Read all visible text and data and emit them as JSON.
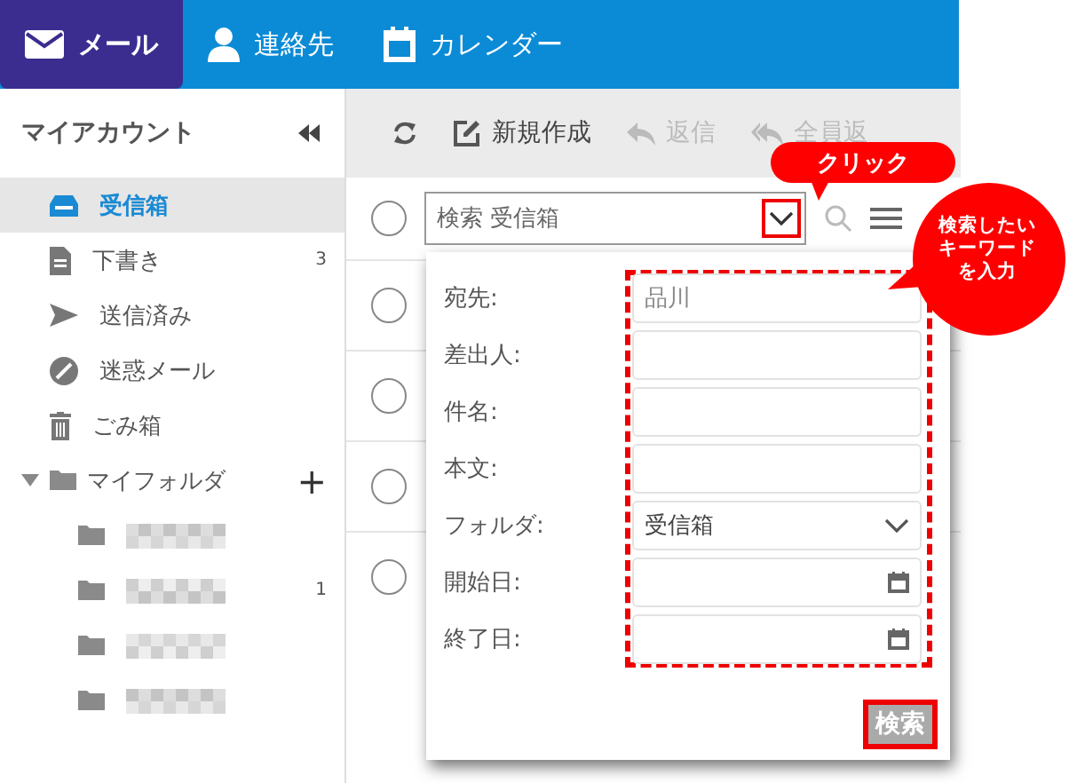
{
  "nav_tabs": [
    {
      "label": "メール",
      "selected": true
    },
    {
      "label": "連絡先",
      "selected": false
    },
    {
      "label": "カレンダー",
      "selected": false
    }
  ],
  "sidebar": {
    "title": "マイアカウント",
    "items": [
      {
        "label": "受信箱",
        "selected": true
      },
      {
        "label": "下書き",
        "count": "3",
        "selected": false
      },
      {
        "label": "送信済み",
        "selected": false
      },
      {
        "label": "迷惑メール",
        "selected": false
      },
      {
        "label": "ごみ箱",
        "selected": false
      }
    ],
    "my_folders": {
      "label": "マイフォルダ",
      "expanded": true,
      "add": "+",
      "children": [
        {
          "kind": "pixelated"
        },
        {
          "kind": "pixelated",
          "count": "1"
        },
        {
          "kind": "pixelated"
        },
        {
          "kind": "pixelated"
        }
      ]
    }
  },
  "toolbar": [
    {
      "disabled": false
    },
    {
      "label": "新規作成",
      "disabled": false
    },
    {
      "label": "返信",
      "disabled": true
    },
    {
      "label": "全員返",
      "disabled": true
    }
  ],
  "select_all": {
    "checked": false
  },
  "search": {
    "placeholder": "検索 受信箱"
  },
  "message_rows": [
    {
      "checked": false
    },
    {
      "checked": false
    },
    {
      "checked": false
    },
    {
      "checked": false
    }
  ],
  "search_form": {
    "fields": [
      {
        "label": "宛先:",
        "kind": "text",
        "placeholder": "品川"
      },
      {
        "label": "差出人:",
        "kind": "text"
      },
      {
        "label": "件名:",
        "kind": "text"
      },
      {
        "label": "本文:",
        "kind": "text"
      },
      {
        "label": "フォルダ:",
        "kind": "select",
        "value": "受信箱"
      },
      {
        "label": "開始日:",
        "kind": "date"
      },
      {
        "label": "終了日:",
        "kind": "date"
      }
    ],
    "button": "検索"
  },
  "callouts": [
    {
      "kind": "pill",
      "text": "クリック"
    },
    {
      "kind": "circle",
      "text": "検索したいキーワードを入力"
    }
  ]
}
